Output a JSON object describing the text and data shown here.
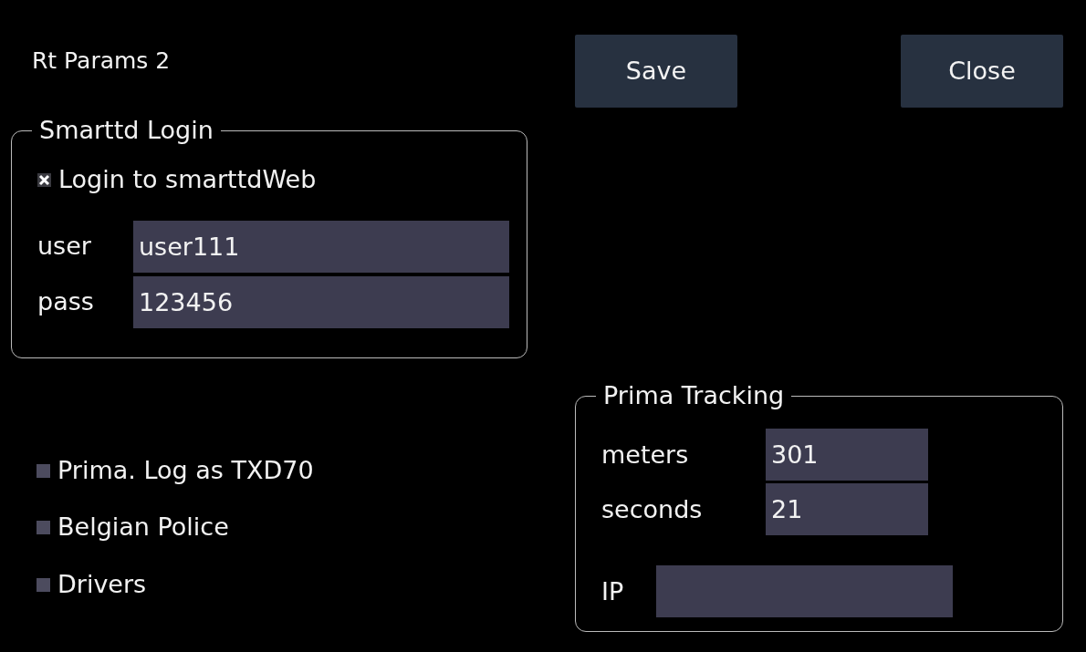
{
  "window": {
    "title": "Rt Params 2"
  },
  "buttons": [
    {
      "label": "Save"
    },
    {
      "label": "Close"
    }
  ],
  "smarttd_login": {
    "legend": "Smarttd Login",
    "checkbox": {
      "label": "Login to smarttdWeb",
      "checked": true
    },
    "fields": [
      {
        "label": "user",
        "value": "user111"
      },
      {
        "label": "pass",
        "value": "123456"
      }
    ]
  },
  "options": [
    {
      "label": "Prima. Log as TXD70",
      "checked": false
    },
    {
      "label": "Belgian Police",
      "checked": false
    },
    {
      "label": "Drivers",
      "checked": false
    }
  ],
  "prima_tracking": {
    "legend": "Prima Tracking",
    "fields": [
      {
        "label": "meters",
        "value": "301"
      },
      {
        "label": "seconds",
        "value": "21"
      }
    ],
    "ip": {
      "label": "IP"
    }
  }
}
